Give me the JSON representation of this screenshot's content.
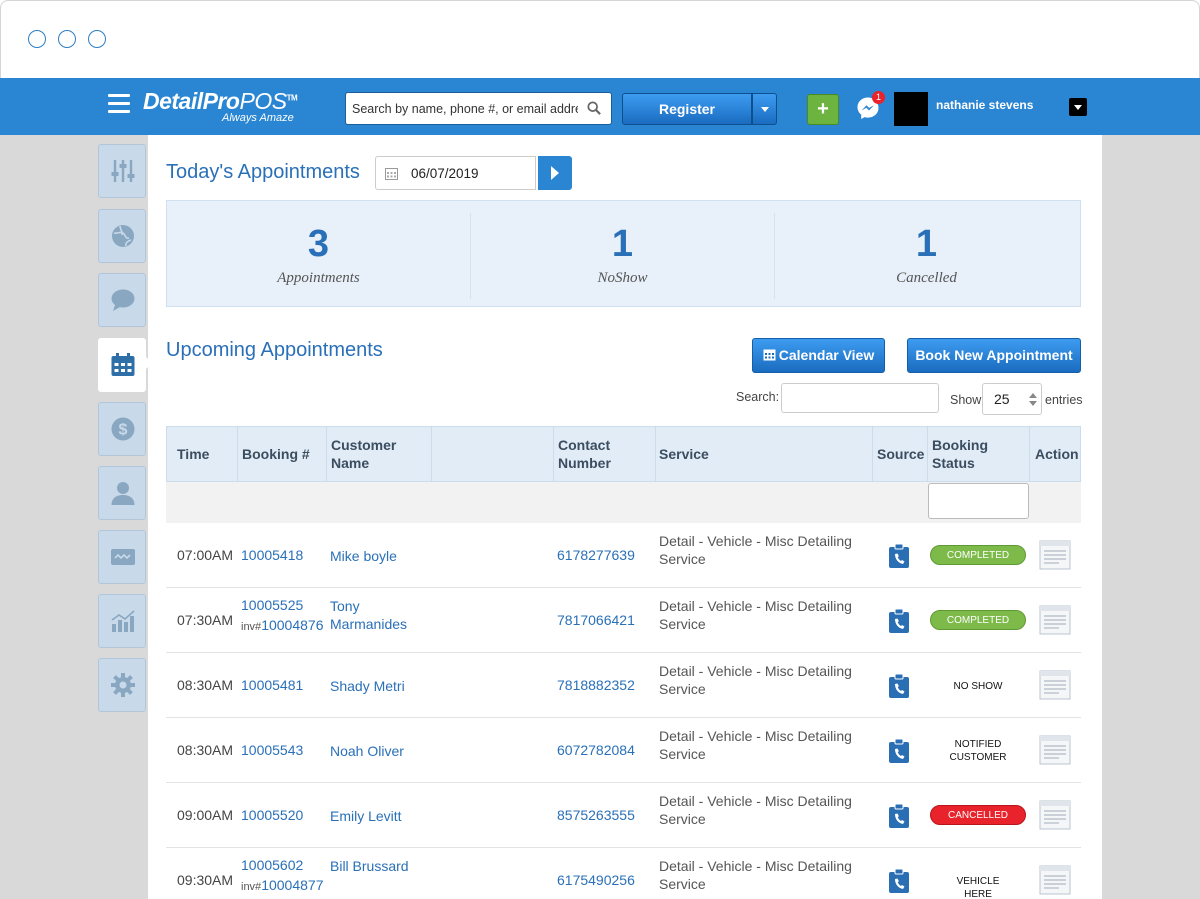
{
  "brand": {
    "name_bold": "DetailPro",
    "name_light": "POS",
    "trademark": "TM",
    "tagline": "Always Amaze"
  },
  "header": {
    "search_placeholder": "Search by name, phone #, or email address",
    "register_label": "Register",
    "add_label": "+",
    "messages_badge": "1",
    "user_name": "nathanie stevens"
  },
  "sidebar": {
    "items": [
      {
        "name": "settings-sliders",
        "icon": "sliders-icon",
        "active": false
      },
      {
        "name": "globe",
        "icon": "globe-icon",
        "active": false
      },
      {
        "name": "chat",
        "icon": "chat-icon",
        "active": false
      },
      {
        "name": "calendar",
        "icon": "calendar-icon",
        "active": true
      },
      {
        "name": "payments",
        "icon": "dollar-icon",
        "active": false
      },
      {
        "name": "customers",
        "icon": "user-icon",
        "active": false
      },
      {
        "name": "cards",
        "icon": "card-icon",
        "active": false
      },
      {
        "name": "reports",
        "icon": "chart-icon",
        "active": false
      },
      {
        "name": "settings",
        "icon": "gear-icon",
        "active": false
      }
    ]
  },
  "today": {
    "title": "Today's Appointments",
    "date": "06/07/2019",
    "stats": [
      {
        "value": "3",
        "label": "Appointments"
      },
      {
        "value": "1",
        "label": "NoShow"
      },
      {
        "value": "1",
        "label": "Cancelled"
      }
    ]
  },
  "upcoming": {
    "title": "Upcoming Appointments",
    "calendar_view_label": "Calendar View",
    "book_new_label": "Book New Appointment",
    "search_label": "Search:",
    "show_label": "Show",
    "entries_value": "25",
    "entries_label": "entries",
    "columns": [
      "Time",
      "Booking #",
      "Customer Name",
      "",
      "Contact Number",
      "Service",
      "Source",
      "Booking Status",
      "Action"
    ],
    "rows": [
      {
        "time": "07:00AM",
        "booking": "10005418",
        "invoice": "",
        "customer": "Mike boyle",
        "contact": "6178277639",
        "service": "Detail - Vehicle - Misc Detailing Service",
        "status": "COMPLETED",
        "status_style": "green"
      },
      {
        "time": "07:30AM",
        "booking": "10005525",
        "invoice": "10004876",
        "customer": "Tony Marmanides",
        "contact": "7817066421",
        "service": "Detail - Vehicle - Misc Detailing Service",
        "status": "COMPLETED",
        "status_style": "green"
      },
      {
        "time": "08:30AM",
        "booking": "10005481",
        "invoice": "",
        "customer": "Shady Metri",
        "contact": "7818882352",
        "service": "Detail - Vehicle - Misc Detailing Service",
        "status": "NO SHOW",
        "status_style": "plain"
      },
      {
        "time": "08:30AM",
        "booking": "10005543",
        "invoice": "",
        "customer": "Noah Oliver",
        "contact": "6072782084",
        "service": "Detail - Vehicle - Misc Detailing Service",
        "status": "NOTIFIED CUSTOMER",
        "status_style": "plain"
      },
      {
        "time": "09:00AM",
        "booking": "10005520",
        "invoice": "",
        "customer": "Emily Levitt",
        "contact": "8575263555",
        "service": "Detail - Vehicle - Misc Detailing Service",
        "status": "CANCELLED",
        "status_style": "red"
      },
      {
        "time": "09:30AM",
        "booking": "10005602",
        "invoice": "10004877",
        "customer": "Bill Brussard",
        "contact": "6175490256",
        "service": "Detail - Vehicle - Misc Detailing Service",
        "status": "VEHICLE HERE",
        "status_style": "plain"
      }
    ],
    "invoice_prefix": "inv#"
  },
  "colors": {
    "brand_blue": "#2a86d3",
    "title_blue": "#2a70b8",
    "status_green": "#7dba4a",
    "status_red": "#e8232b",
    "add_green": "#6cb33f"
  }
}
